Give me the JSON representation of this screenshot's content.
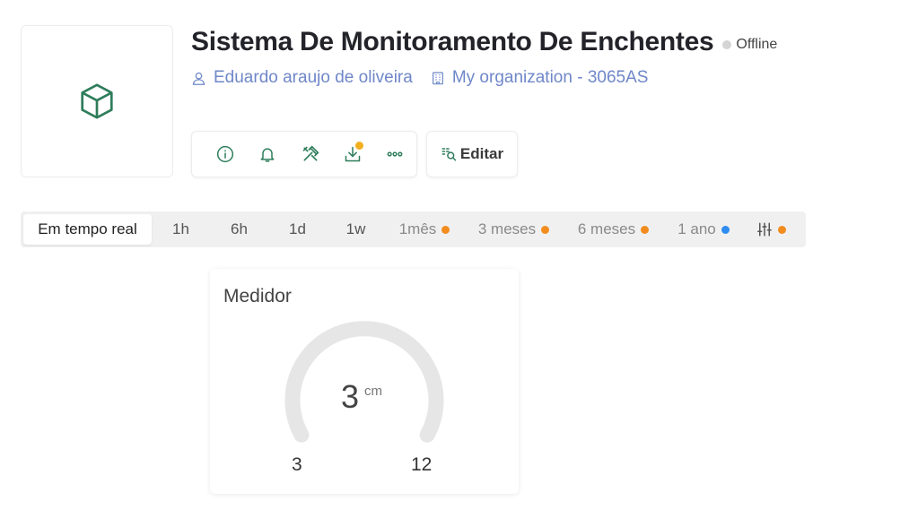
{
  "device": {
    "icon": "cube-icon",
    "title": "Sistema De Monitoramento De Enchentes",
    "status": "Offline",
    "status_color": "#d4d4d4",
    "owner": "Eduardo araujo de oliveira",
    "organization": "My organization - 3065AS"
  },
  "toolbar": {
    "buttons": [
      {
        "icon": "info-icon"
      },
      {
        "icon": "bell-icon"
      },
      {
        "icon": "tools-icon"
      },
      {
        "icon": "download-icon",
        "badge_color": "#f2b01e"
      },
      {
        "icon": "more-icon"
      }
    ],
    "edit_label": "Editar",
    "edit_icon": "edit-icon"
  },
  "time_ranges": {
    "items": [
      {
        "label": "Em tempo real",
        "active": true
      },
      {
        "label": "1h"
      },
      {
        "label": "6h"
      },
      {
        "label": "1d"
      },
      {
        "label": "1w"
      },
      {
        "label": "1mês",
        "dot": "#f28c1e"
      },
      {
        "label": "3 meses",
        "dot": "#f28c1e"
      },
      {
        "label": "6 meses",
        "dot": "#f28c1e"
      },
      {
        "label": "1 ano",
        "dot": "#2f8cf0"
      },
      {
        "icon": "sliders-icon",
        "dot": "#f28c1e"
      }
    ]
  },
  "widget": {
    "title": "Medidor",
    "value": "3",
    "unit": "cm",
    "min": "3",
    "max": "12",
    "track_color": "#e6e6e6"
  },
  "colors": {
    "accent": "#2e7d5b",
    "link": "#6f87c9"
  }
}
